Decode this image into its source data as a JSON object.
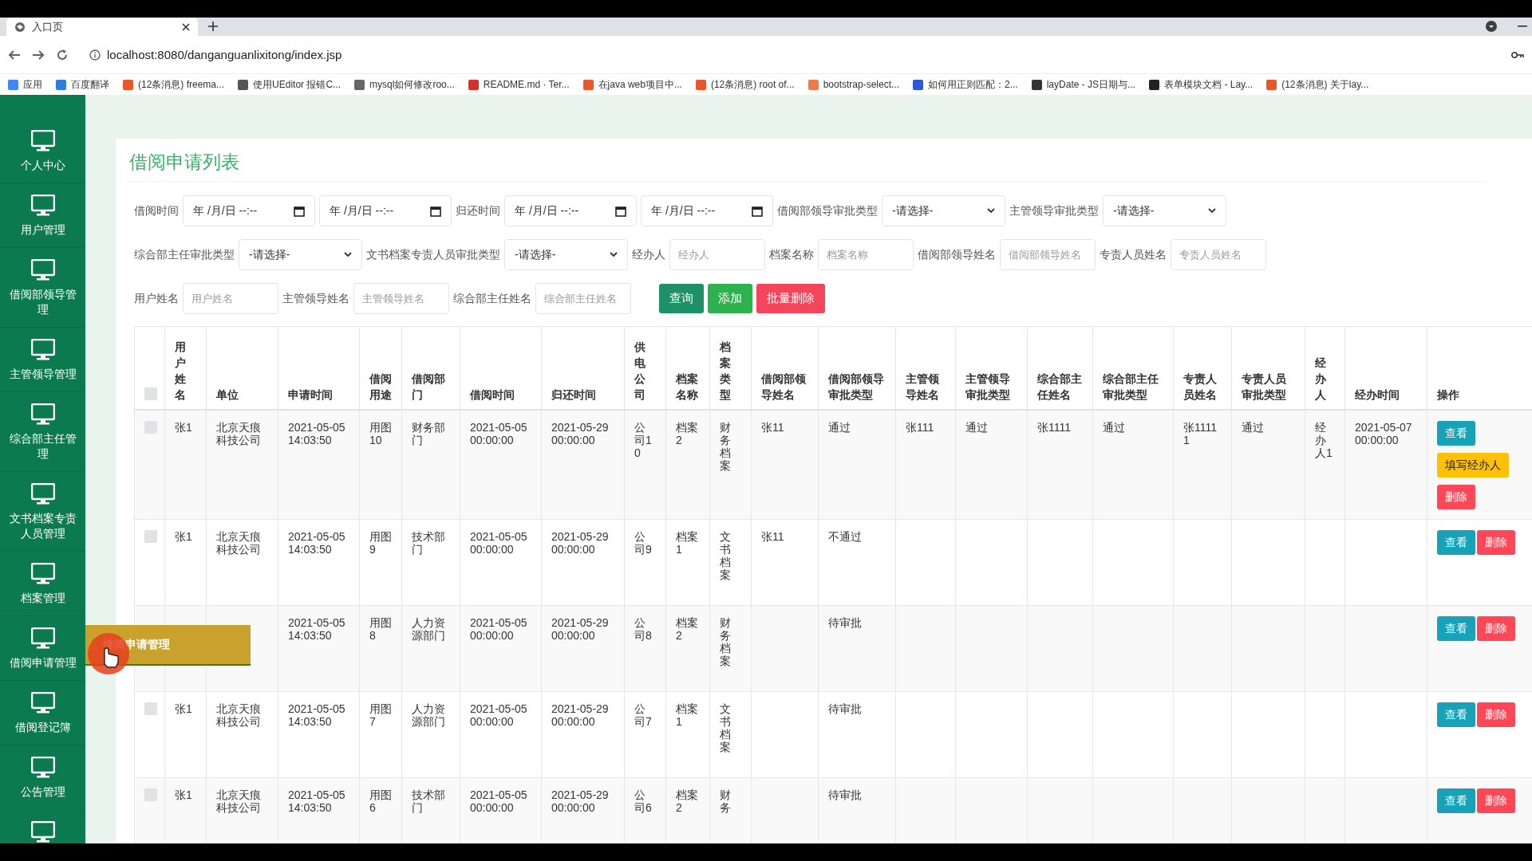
{
  "browser": {
    "tab": {
      "title": "入口页"
    },
    "url": "localhost:8080/danganguanlixitong/index.jsp",
    "bookmarks": [
      {
        "label": "应用",
        "color": "#4285f4"
      },
      {
        "label": "百度翻译",
        "color": "#2f7de1"
      },
      {
        "label": "(12条消息) freema...",
        "color": "#e8562a"
      },
      {
        "label": "使用UEditor 报错C...",
        "color": "#555555"
      },
      {
        "label": "mysql如何修改roo...",
        "color": "#666666"
      },
      {
        "label": "README.md · Ter...",
        "color": "#d93025"
      },
      {
        "label": "在java web项目中...",
        "color": "#e8562a"
      },
      {
        "label": "(12条消息) root of...",
        "color": "#e8562a"
      },
      {
        "label": "bootstrap-select...",
        "color": "#f07a46"
      },
      {
        "label": "如何用正则匹配：2...",
        "color": "#3058d6"
      },
      {
        "label": "layDate - JS日期与...",
        "color": "#333333"
      },
      {
        "label": "表单模块文档 - Lay...",
        "color": "#222222"
      },
      {
        "label": "(12条消息) 关于lay...",
        "color": "#e8562a"
      }
    ]
  },
  "sidebar": {
    "items": [
      {
        "label": "个人中心"
      },
      {
        "label": "用户管理"
      },
      {
        "label": "借阅部领导管理"
      },
      {
        "label": "主管领导管理"
      },
      {
        "label": "综合部主任管理"
      },
      {
        "label": "文书档案专责人员管理"
      },
      {
        "label": "档案管理"
      },
      {
        "label": "借阅申请管理"
      },
      {
        "label": "借阅登记簿"
      },
      {
        "label": "公告管理"
      }
    ]
  },
  "tooltip": {
    "text": "借阅申请管理"
  },
  "page": {
    "title": "借阅申请列表"
  },
  "filters": [
    [
      {
        "kind": "label",
        "text": "借阅时间"
      },
      {
        "kind": "date",
        "text": "年 /月/日 --:--"
      },
      {
        "kind": "date",
        "text": "年 /月/日 --:--"
      },
      {
        "kind": "label",
        "text": "归还时间"
      },
      {
        "kind": "date",
        "text": "年 /月/日 --:--"
      },
      {
        "kind": "date",
        "text": "年 /月/日 --:--"
      },
      {
        "kind": "label",
        "text": "借阅部领导审批类型"
      },
      {
        "kind": "select",
        "text": "-请选择-"
      },
      {
        "kind": "label",
        "text": "主管领导审批类型"
      },
      {
        "kind": "select",
        "text": "-请选择-"
      }
    ],
    [
      {
        "kind": "label",
        "text": "综合部主任审批类型"
      },
      {
        "kind": "select",
        "text": "-请选择-"
      },
      {
        "kind": "label",
        "text": "文书档案专责人员审批类型"
      },
      {
        "kind": "select",
        "text": "-请选择-"
      },
      {
        "kind": "label",
        "text": "经办人"
      },
      {
        "kind": "input",
        "placeholder": "经办人"
      },
      {
        "kind": "label",
        "text": "档案名称"
      },
      {
        "kind": "input",
        "placeholder": "档案名称"
      },
      {
        "kind": "label",
        "text": "借阅部领导姓名"
      },
      {
        "kind": "input",
        "placeholder": "借阅部领导姓名"
      },
      {
        "kind": "label",
        "text": "专责人员姓名"
      },
      {
        "kind": "input",
        "placeholder": "专责人员姓名"
      }
    ],
    [
      {
        "kind": "label",
        "text": "用户姓名"
      },
      {
        "kind": "input",
        "placeholder": "用户姓名"
      },
      {
        "kind": "label",
        "text": "主管领导姓名"
      },
      {
        "kind": "input",
        "placeholder": "主管领导姓名"
      },
      {
        "kind": "label",
        "text": "综合部主任姓名"
      },
      {
        "kind": "input",
        "placeholder": "综合部主任姓名"
      },
      {
        "kind": "query",
        "text": "查询"
      },
      {
        "kind": "add",
        "text": "添加"
      },
      {
        "kind": "delete",
        "text": "批量删除"
      }
    ]
  ],
  "table": {
    "all_selected": false,
    "columns": [
      "用户姓名",
      "单位",
      "申请时间",
      "借阅用途",
      "借阅部门",
      "借阅时间",
      "归还时间",
      "供电公司",
      "档案名称",
      "档案类型",
      "借阅部领导姓名",
      "借阅部领导审批类型",
      "主管领导姓名",
      "主管领导审批类型",
      "综合部主任姓名",
      "综合部主任审批类型",
      "专责人员姓名",
      "专责人员审批类型",
      "经办人",
      "经办时间",
      "操作"
    ],
    "rows": [
      {
        "selected": false,
        "cells": [
          "张1",
          "北京天痕科技公司",
          "2021-05-05 14:03:50",
          "用图10",
          "财务部门",
          "2021-05-05 00:00:00",
          "2021-05-29 00:00:00",
          "公司10",
          "档案2",
          "财务档案",
          "张11",
          "通过",
          "张111",
          "通过",
          "张1111",
          "通过",
          "张11111",
          "通过",
          "经办人1",
          "2021-05-07 00:00:00"
        ],
        "actions": [
          {
            "kind": "view",
            "text": "查看"
          },
          {
            "kind": "fill",
            "text": "填写经办人"
          },
          {
            "kind": "delete",
            "text": "删除"
          }
        ]
      },
      {
        "selected": false,
        "cells": [
          "张1",
          "北京天痕科技公司",
          "2021-05-05 14:03:50",
          "用图9",
          "技术部门",
          "2021-05-05 00:00:00",
          "2021-05-29 00:00:00",
          "公司9",
          "档案1",
          "文书档案",
          "张11",
          "不通过",
          null,
          null,
          null,
          null,
          null,
          null,
          null,
          null
        ],
        "actions": [
          {
            "kind": "view",
            "text": "查看"
          },
          {
            "kind": "delete",
            "text": "删除"
          }
        ]
      },
      {
        "cells": [
          null,
          null,
          "2021-05-05 14:03:50",
          "用图8",
          "人力资源部门",
          "2021-05-05 00:00:00",
          "2021-05-29 00:00:00",
          "公司8",
          "档案2",
          "财务档案",
          null,
          "待审批",
          null,
          null,
          null,
          null,
          null,
          null,
          null,
          null
        ],
        "actions": [
          {
            "kind": "view",
            "text": "查看"
          },
          {
            "kind": "delete",
            "text": "删除"
          }
        ]
      },
      {
        "selected": false,
        "cells": [
          "张1",
          "北京天痕科技公司",
          "2021-05-05 14:03:50",
          "用图7",
          "人力资源部门",
          "2021-05-05 00:00:00",
          "2021-05-29 00:00:00",
          "公司7",
          "档案1",
          "文书档案",
          null,
          "待审批",
          null,
          null,
          null,
          null,
          null,
          null,
          null,
          null
        ],
        "actions": [
          {
            "kind": "view",
            "text": "查看"
          },
          {
            "kind": "delete",
            "text": "删除"
          }
        ]
      },
      {
        "selected": false,
        "cells": [
          "张1",
          "北京天痕科技公司",
          "2021-05-05 14:03:50",
          "用图6",
          "技术部门",
          "2021-05-05 00:00:00",
          "2021-05-29 00:00:00",
          "公司6",
          "档案2",
          "财务",
          null,
          "待审批",
          null,
          null,
          null,
          null,
          null,
          null,
          null,
          null
        ],
        "actions": [
          {
            "kind": "view",
            "text": "查看"
          },
          {
            "kind": "delete",
            "text": "删除"
          }
        ]
      }
    ]
  }
}
